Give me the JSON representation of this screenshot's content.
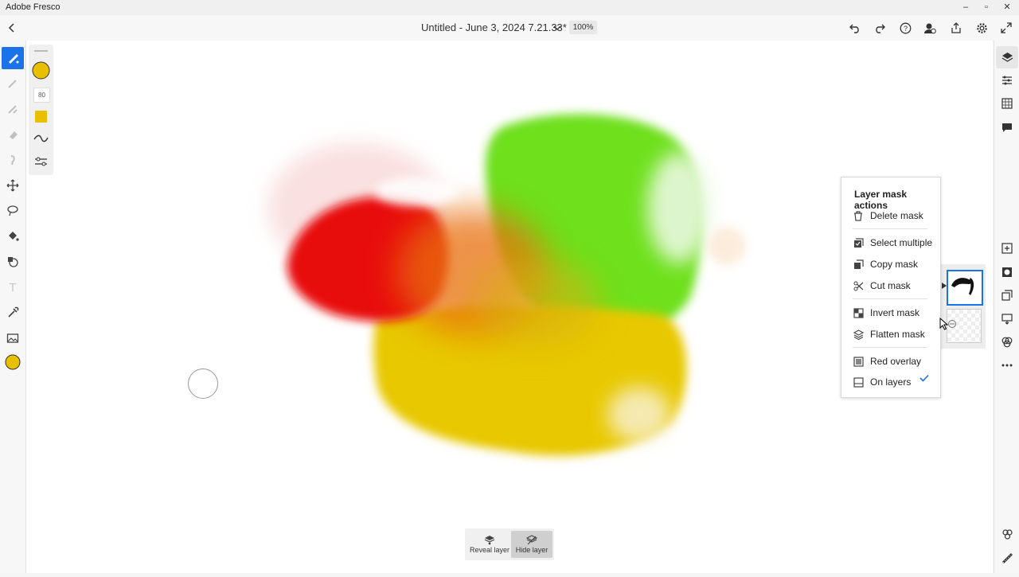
{
  "window": {
    "app_name": "Adobe Fresco",
    "minimize": "–",
    "maximize": "▫",
    "close": "✕"
  },
  "header": {
    "doc_title": "Untitled - June 3, 2024 7.21.33*",
    "zoom": "100%"
  },
  "props": {
    "brush_size": "80",
    "brush_color": "#e8c000"
  },
  "layer_mask_menu": {
    "title": "Layer mask actions",
    "items": [
      {
        "label": "Delete mask",
        "icon": "trash-icon"
      },
      {
        "label": "Select multiple",
        "icon": "select-multiple-icon"
      },
      {
        "label": "Copy mask",
        "icon": "copy-icon"
      },
      {
        "label": "Cut mask",
        "icon": "scissors-icon"
      },
      {
        "label": "Invert mask",
        "icon": "invert-icon"
      },
      {
        "label": "Flatten mask",
        "icon": "flatten-icon"
      },
      {
        "label": "Red overlay",
        "icon": "overlay-icon"
      },
      {
        "label": "On layers",
        "icon": "on-layers-icon",
        "checked": true
      }
    ]
  },
  "bottom_actions": {
    "reveal_label": "Reveal layer",
    "hide_label": "Hide layer"
  },
  "colors": {
    "accent": "#1a73e8",
    "red": "#e81010",
    "green": "#6ee01a",
    "yellow": "#e8c800",
    "orange": "#e87010"
  }
}
